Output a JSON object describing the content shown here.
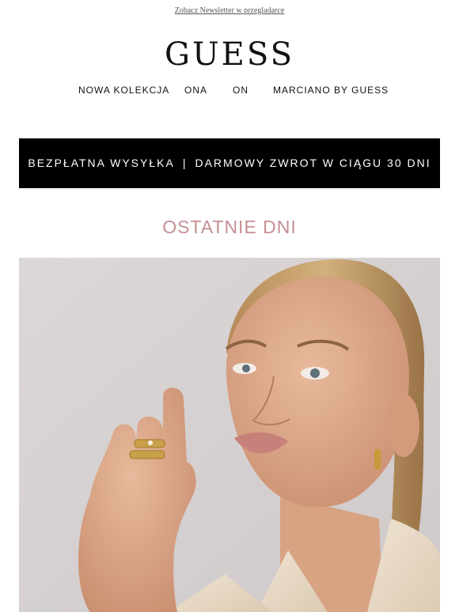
{
  "preheader": {
    "view_in_browser": "Zobacz Newsletter w przegladarce"
  },
  "brand": {
    "logo": "GUESS"
  },
  "nav": {
    "items": [
      {
        "label": "NOWA KOLEKCJA"
      },
      {
        "label": "ONA"
      },
      {
        "label": "ON"
      },
      {
        "label": "MARCIANO BY GUESS"
      }
    ]
  },
  "banner": {
    "left": "BEZPŁATNA WYSYŁKA",
    "separator": "|",
    "right": "DARMOWY ZWROT W CIĄGU 30 DNI"
  },
  "headline": {
    "text": "OSTATNIE DNI"
  },
  "colors": {
    "headline": "#c58f94",
    "banner_bg": "#000000",
    "hero_bg": "#d6d1d1"
  }
}
